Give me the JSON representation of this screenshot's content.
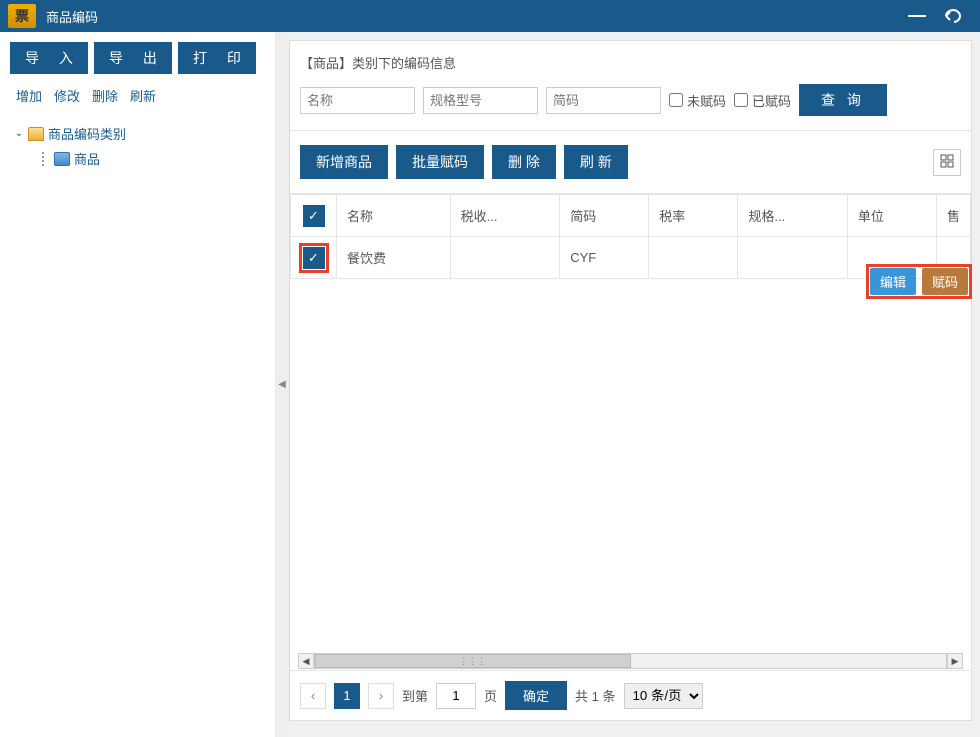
{
  "titlebar": {
    "title": "商品编码"
  },
  "sidebar": {
    "buttons": {
      "import": "导 入",
      "export": "导 出",
      "print": "打 印"
    },
    "links": {
      "add": "增加",
      "edit": "修改",
      "delete": "删除",
      "refresh": "刷新"
    },
    "tree": {
      "root": "商品编码类别",
      "child": "商品"
    }
  },
  "main": {
    "header": "【商品】类别下的编码信息",
    "filters": {
      "name_ph": "名称",
      "spec_ph": "规格型号",
      "short_ph": "简码",
      "uncoded": "未赋码",
      "coded": "已赋码",
      "query": "查 询"
    },
    "toolbar": {
      "add": "新增商品",
      "batch": "批量赋码",
      "delete": "删  除",
      "refresh": "刷  新"
    },
    "columns": [
      "名称",
      "税收...",
      "简码",
      "税率",
      "规格...",
      "单位",
      "售"
    ],
    "rows": [
      {
        "name": "餐饮费",
        "tax": "",
        "short": "CYF",
        "rate": "",
        "spec": "",
        "unit": ""
      }
    ],
    "row_actions": {
      "edit": "编辑",
      "code": "赋码"
    },
    "pager": {
      "goto": "到第",
      "page_suffix": "页",
      "confirm": "确定",
      "total": "共 1 条",
      "per_page": "10 条/页",
      "current": "1",
      "input": "1"
    }
  }
}
